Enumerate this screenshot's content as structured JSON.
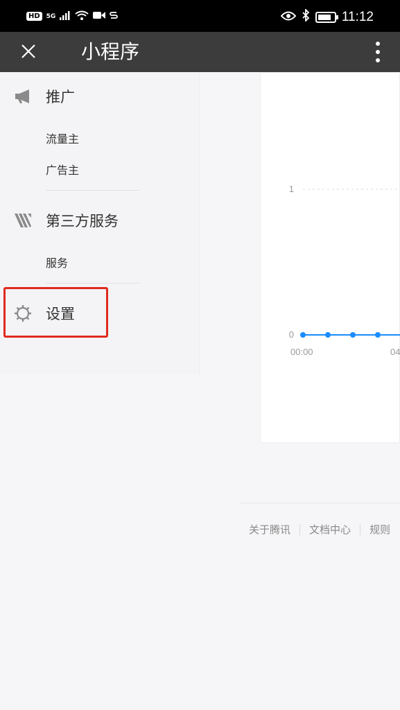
{
  "status_bar": {
    "hd": "HD",
    "signal": "5G",
    "time": "11:12"
  },
  "title_bar": {
    "close_icon": "close-icon",
    "title": "小程序",
    "more_icon": "more-vertical-icon"
  },
  "sidebar": {
    "sections": [
      {
        "label": "推广",
        "icon": "megaphone-icon",
        "items": [
          "流量主",
          "广告主"
        ]
      },
      {
        "label": "第三方服务",
        "icon": "third-party-icon",
        "items": [
          "服务"
        ]
      },
      {
        "label": "设置",
        "icon": "gear-icon",
        "items": []
      }
    ],
    "highlight_color": "#e02a1e"
  },
  "chart_data": {
    "type": "line",
    "y_ticks": [
      "1",
      "0"
    ],
    "x_ticks": [
      "00:00",
      "04"
    ],
    "series": [
      {
        "values": [
          0,
          0,
          0,
          0,
          0
        ]
      }
    ],
    "ylim": [
      0,
      1
    ],
    "color": "#1a8cff"
  },
  "footer": {
    "links": [
      "关于腾讯",
      "文档中心",
      "规则"
    ]
  }
}
